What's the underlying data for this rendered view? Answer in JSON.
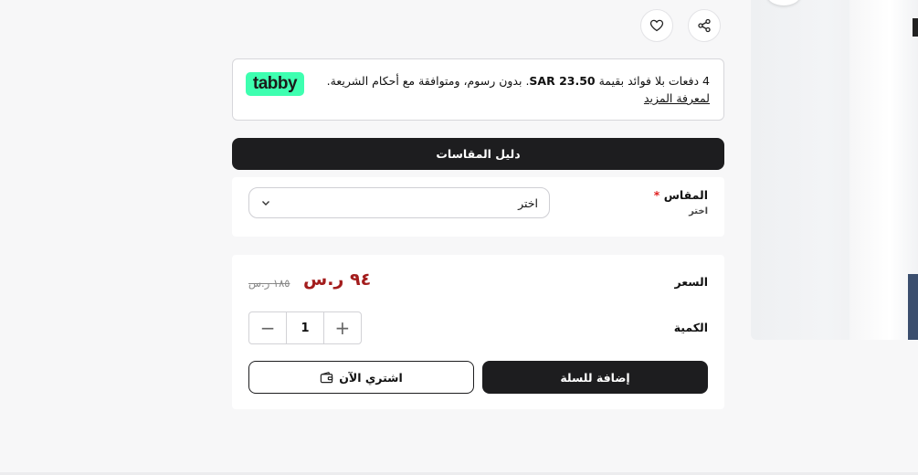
{
  "tabby": {
    "logo": "tabby",
    "text_prefix": "4 دفعات بلا فوائد بقيمة",
    "amount": "SAR 23.50",
    "text_suffix": ". بدون رسوم، ومتوافقة مع أحكام الشريعة.",
    "link": "لمعرفة المزيد",
    "brand_color": "#3effb0"
  },
  "size_guide": {
    "label": "دليل المقاسات"
  },
  "size": {
    "label": "المقاس",
    "required_mark": "*",
    "sub_label": "اختر",
    "select_value": "اختر"
  },
  "price": {
    "label": "السعر",
    "current": "٩٤ ر.س",
    "original": "١٨٥ ر.س",
    "current_color": "#a31c1c"
  },
  "quantity": {
    "label": "الكمية",
    "value": "1",
    "minus": "−",
    "plus": "+"
  },
  "actions": {
    "add_to_cart": "إضافة للسلة",
    "buy_now": "اشتري الآن"
  },
  "icons": {
    "share": "share-icon",
    "wishlist": "heart-icon",
    "chevron": "chevron-down-icon",
    "wallet": "wallet-icon"
  }
}
